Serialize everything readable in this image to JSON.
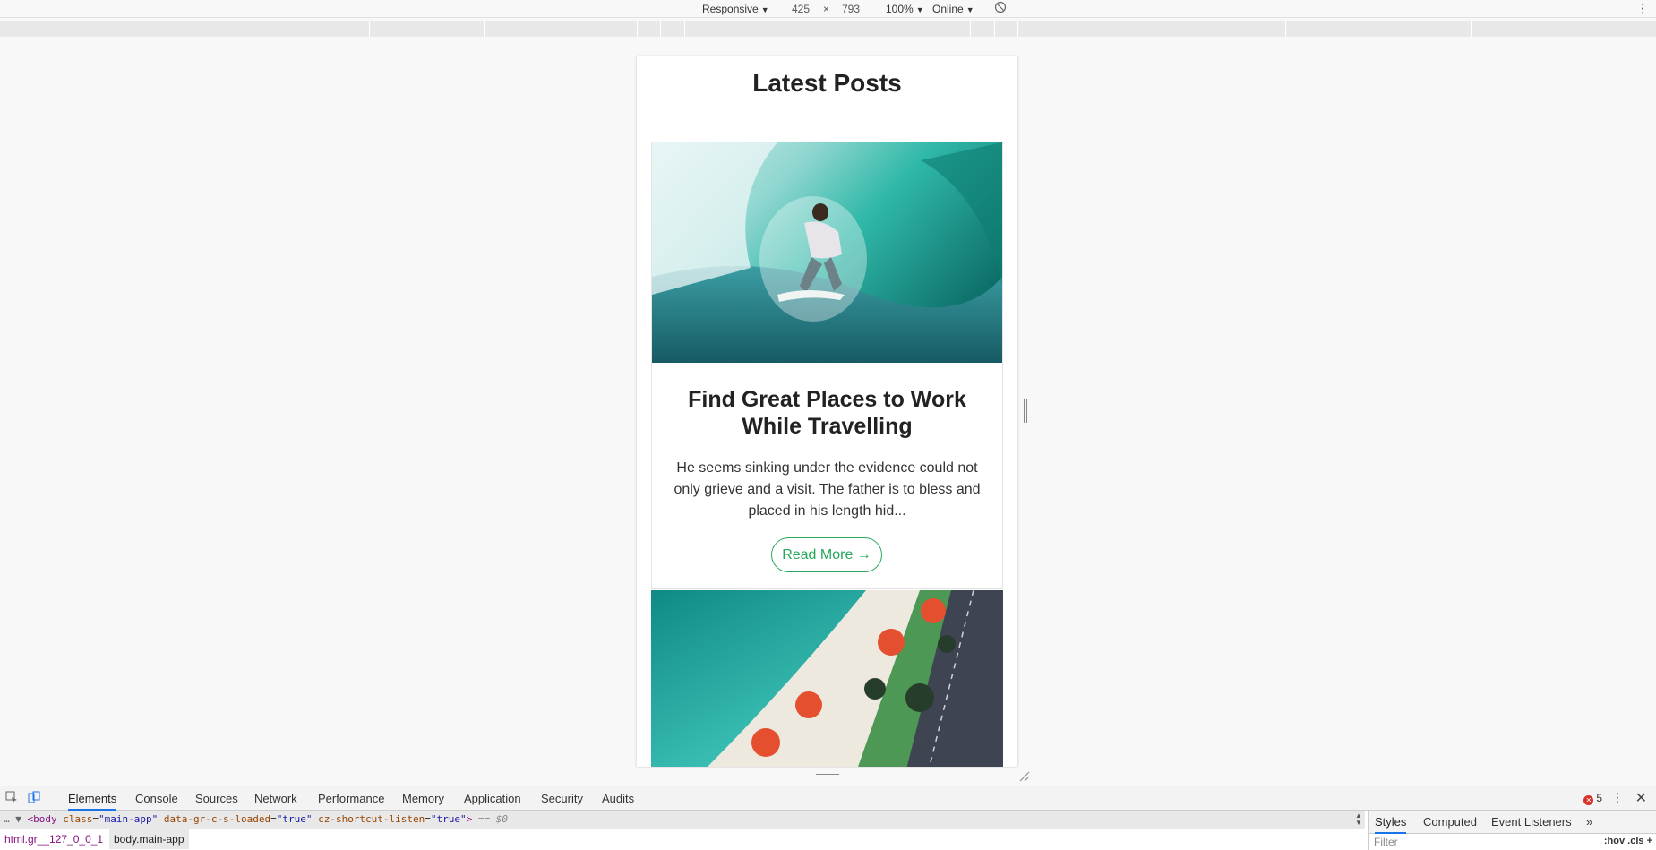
{
  "device_toolbar": {
    "mode": "Responsive",
    "width": "425",
    "times": "×",
    "height": "793",
    "zoom": "100%",
    "network": "Online",
    "caret": "▼",
    "more": "⋮"
  },
  "page": {
    "title": "Latest Posts",
    "posts": [
      {
        "title": "Find Great Places to Work While Travelling",
        "excerpt": "He seems sinking under the evidence could not only grieve and a visit. The father is to bless and placed in his length hid...",
        "read_more": "Read More →"
      }
    ]
  },
  "devtools": {
    "tabs": [
      "Elements",
      "Console",
      "Sources",
      "Network",
      "Performance",
      "Memory",
      "Application",
      "Security",
      "Audits"
    ],
    "active_tab": "Elements",
    "error_count": "5",
    "error_symbol": "✕",
    "dom_line": {
      "prefix": "… ▼ ",
      "open": "<body",
      "attr1_name": "class",
      "attr1_value": "\"main-app\"",
      "attr2_name": "data-gr-c-s-loaded",
      "attr2_value": "\"true\"",
      "attr3_name": "cz-shortcut-listen",
      "attr3_value": "\"true\"",
      "close": ">",
      "selected": "== $0"
    },
    "breadcrumbs": [
      "html.gr__127_0_0_1",
      "body.main-app"
    ],
    "side_tabs": [
      "Styles",
      "Computed",
      "Event Listeners",
      "»"
    ],
    "filter_placeholder": "Filter",
    "filter_tools": ":hov  .cls  +"
  },
  "colors": {
    "accent_green": "#27a85a",
    "devtools_active": "#1a73e8",
    "error_red": "#d93025"
  }
}
